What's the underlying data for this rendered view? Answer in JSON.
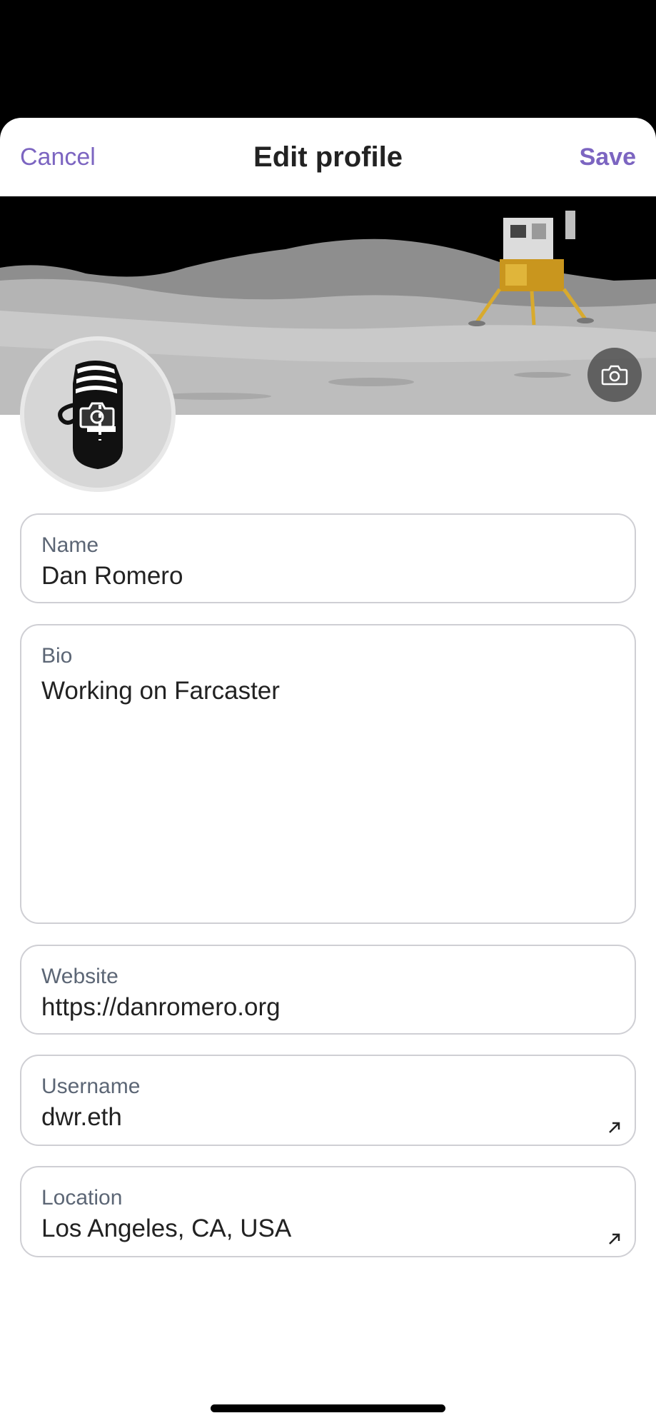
{
  "header": {
    "cancel_label": "Cancel",
    "title": "Edit profile",
    "save_label": "Save"
  },
  "banner": {
    "image": "lunar-module-on-moon-surface",
    "camera_icon": "camera-icon"
  },
  "avatar": {
    "image": "profile-avatar-illustration",
    "camera_icon": "camera-icon"
  },
  "fields": {
    "name": {
      "label": "Name",
      "value": "Dan Romero"
    },
    "bio": {
      "label": "Bio",
      "value": "Working on Farcaster"
    },
    "website": {
      "label": "Website",
      "value": "https://danromero.org"
    },
    "username": {
      "label": "Username",
      "value": "dwr.eth",
      "icon": "arrow-up-right-icon"
    },
    "location": {
      "label": "Location",
      "value": "Los Angeles, CA, USA",
      "icon": "arrow-up-right-icon"
    }
  },
  "colors": {
    "accent": "#7c65c1",
    "label": "#5c6675",
    "text": "#222222",
    "border": "#cfcfd4"
  }
}
